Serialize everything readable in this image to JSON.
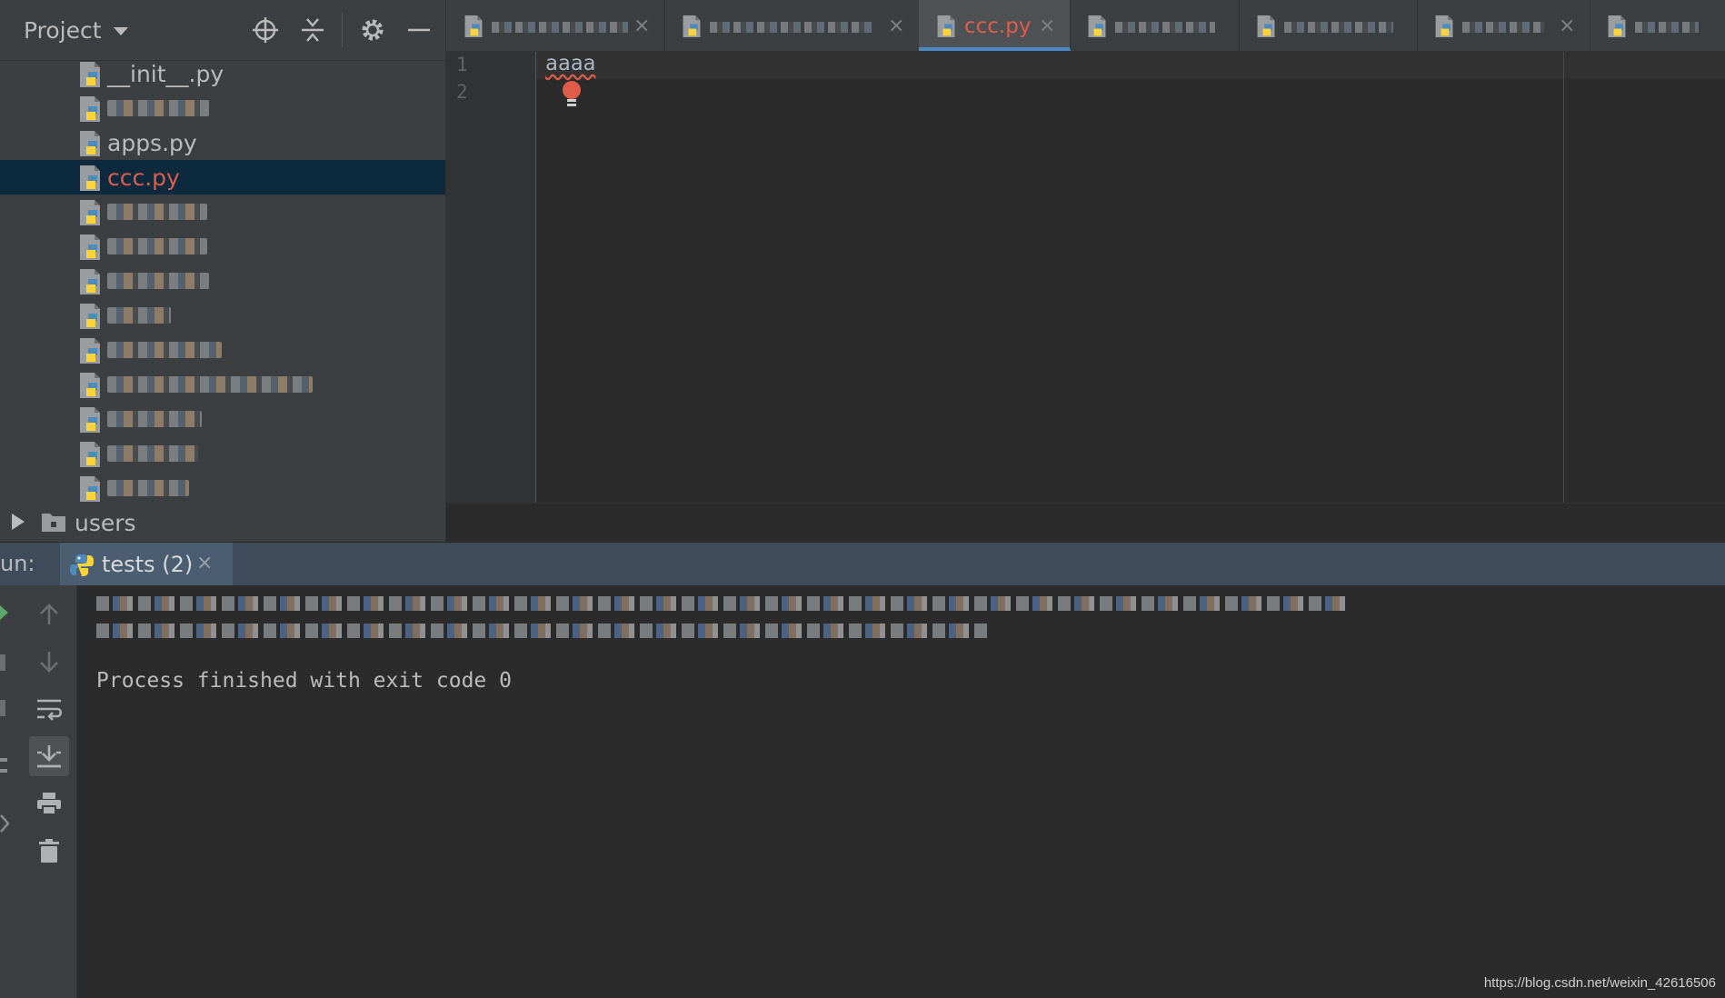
{
  "project_panel": {
    "title": "Project",
    "files": [
      {
        "name": "__init__.py",
        "blurred": false
      },
      {
        "name": "",
        "blurred": true,
        "blur_width": 112
      },
      {
        "name": "apps.py",
        "blurred": false
      },
      {
        "name": "ccc.py",
        "blurred": false,
        "selected": true,
        "color": "#e05c4a"
      },
      {
        "name": "",
        "blurred": true,
        "blur_width": 110
      },
      {
        "name": "",
        "blurred": true,
        "blur_width": 110
      },
      {
        "name": "",
        "blurred": true,
        "blur_width": 112
      },
      {
        "name": "",
        "blurred": true,
        "blur_width": 70
      },
      {
        "name": "",
        "blurred": true,
        "blur_width": 126
      },
      {
        "name": "",
        "blurred": true,
        "blur_width": 226
      },
      {
        "name": "",
        "blurred": true,
        "blur_width": 104
      },
      {
        "name": "",
        "blurred": true,
        "blur_width": 100
      },
      {
        "name": "",
        "blurred": true,
        "blur_width": 90
      }
    ],
    "folder": {
      "name": "users"
    }
  },
  "editor": {
    "tabs": [
      {
        "label": "",
        "blurred": true,
        "blur_width": 150,
        "width": 240,
        "close": "×"
      },
      {
        "label": "",
        "blurred": true,
        "blur_width": 180,
        "width": 280,
        "close": "×"
      },
      {
        "label": "ccc.py",
        "active": true,
        "width": 166,
        "close": "×"
      },
      {
        "label": "",
        "blurred": true,
        "blur_width": 110,
        "width": 186,
        "close": ""
      },
      {
        "label": "",
        "blurred": true,
        "blur_width": 120,
        "width": 196,
        "close": ""
      },
      {
        "label": "",
        "blurred": true,
        "blur_width": 90,
        "width": 190,
        "close": "×"
      },
      {
        "label": "",
        "blurred": true,
        "blur_width": 70,
        "width": 160,
        "close": ""
      }
    ],
    "line_numbers": [
      "1",
      "2"
    ],
    "code_lines": [
      "aaaa"
    ]
  },
  "run": {
    "label": "un:",
    "tab_label": "tests (2)",
    "tab_close": "×",
    "output_lines": [
      "Process finished with exit code 0"
    ]
  },
  "watermark": "https://blog.csdn.net/weixin_42616506"
}
